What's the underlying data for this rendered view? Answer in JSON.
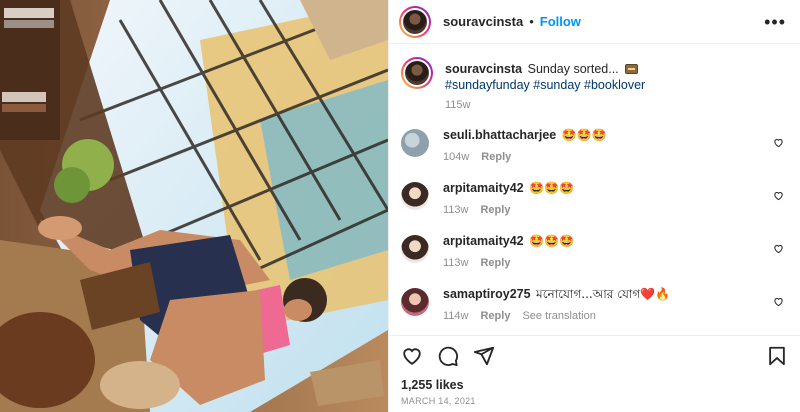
{
  "header": {
    "username": "souravcinsta",
    "separator": "•",
    "follow_label": "Follow",
    "more_icon": "more-options-icon"
  },
  "caption": {
    "username": "souravcinsta",
    "text": "Sunday sorted...",
    "emoji": "book-emoji",
    "hashtags": [
      "#sundayfunday",
      "#sunday",
      "#booklover"
    ],
    "time": "115w"
  },
  "comments": [
    {
      "username": "seuli.bhattacharjee",
      "text": "🤩🤩🤩",
      "time": "104w",
      "reply": "Reply",
      "translation": ""
    },
    {
      "username": "arpitamaity42",
      "text": "🤩🤩🤩",
      "time": "113w",
      "reply": "Reply",
      "translation": ""
    },
    {
      "username": "arpitamaity42",
      "text": "🤩🤩🤩",
      "time": "113w",
      "reply": "Reply",
      "translation": ""
    },
    {
      "username": "samaptiroy275",
      "text": "মনোযোগ...আর যোগ❤️🔥",
      "time": "114w",
      "reply": "Reply",
      "translation": "See translation"
    }
  ],
  "actions": [
    "like-icon",
    "comment-icon",
    "share-icon",
    "save-icon"
  ],
  "likes": "1,255 likes",
  "date": "MARCH 14, 2021",
  "colors": {
    "link": "#0095f6",
    "hashtag": "#00376b",
    "muted": "#8e8e8e",
    "heart": "#ed4956"
  }
}
